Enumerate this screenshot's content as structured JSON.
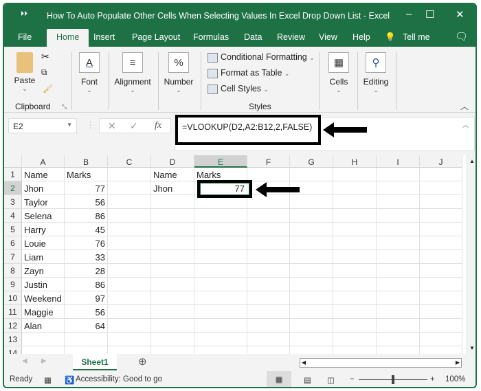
{
  "window": {
    "title": "How To Auto Populate Other Cells When Selecting Values In Excel Drop Down List  -  Excel",
    "minimize": "–",
    "maximize": "☐",
    "close": "✕",
    "qat": "⏵⏵"
  },
  "tabs": [
    "File",
    "Home",
    "Insert",
    "Page Layout",
    "Formulas",
    "Data",
    "Review",
    "View",
    "Help",
    "Tell me"
  ],
  "ribbon": {
    "paste": "Paste",
    "clipboard": "Clipboard",
    "font": "Font",
    "alignment": "Alignment",
    "number": "Number",
    "conditional": "Conditional Formatting",
    "format_table": "Format as Table",
    "cell_styles": "Cell Styles",
    "styles": "Styles",
    "cells": "Cells",
    "editing": "Editing"
  },
  "formula_bar": {
    "name_box": "E2",
    "formula": "=VLOOKUP(D2,A2:B12,2,FALSE)",
    "fx": "fx"
  },
  "columns": [
    "A",
    "B",
    "C",
    "D",
    "E",
    "F",
    "G",
    "H",
    "I",
    "J"
  ],
  "rows": [
    [
      "Name",
      "Marks",
      "",
      "Name",
      "Marks"
    ],
    [
      "Jhon",
      "77",
      "",
      "Jhon",
      "77"
    ],
    [
      "Taylor",
      "56"
    ],
    [
      "Selena",
      "86"
    ],
    [
      "Harry",
      "45"
    ],
    [
      "Louie",
      "76"
    ],
    [
      "Liam",
      "33"
    ],
    [
      "Zayn",
      "28"
    ],
    [
      "Justin",
      "86"
    ],
    [
      "Weekend",
      "97"
    ],
    [
      "Maggie",
      "56"
    ],
    [
      "Alan",
      "64"
    ],
    [],
    []
  ],
  "selected_cell": "E2",
  "sheet_tab": "Sheet1",
  "status": {
    "ready": "Ready",
    "accessibility": "Accessibility: Good to go",
    "zoom": "100%"
  },
  "colors": {
    "accent": "#1e7145"
  }
}
